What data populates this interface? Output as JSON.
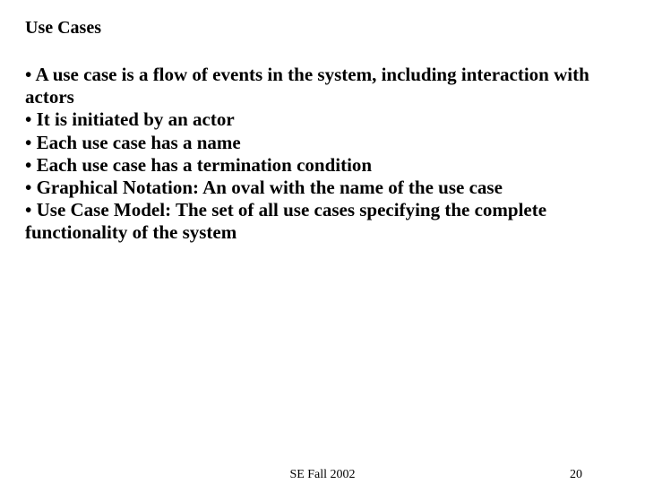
{
  "title": "Use Cases",
  "bullets": [
    "• A use case is a flow of events in the system, including interaction with actors",
    "• It is initiated by an actor",
    "• Each use case has a name",
    "• Each use case has a termination condition",
    "• Graphical Notation: An oval with the name of the use case",
    "• Use Case Model: The set of all use cases specifying the complete functionality of the system"
  ],
  "footer": {
    "center": "SE Fall 2002",
    "page": "20"
  }
}
